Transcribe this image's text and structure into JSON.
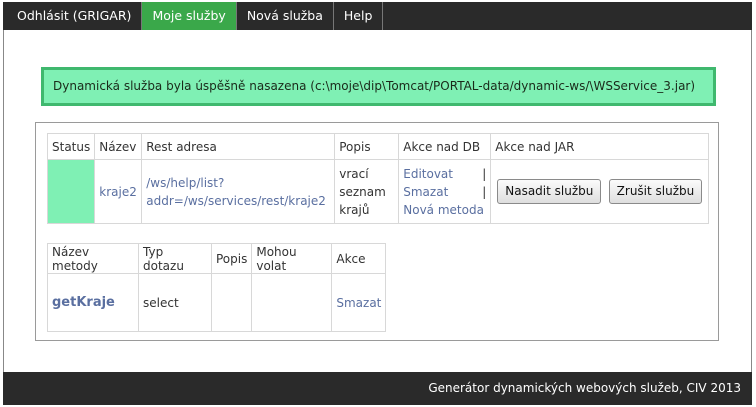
{
  "nav": {
    "items": [
      {
        "label": "Odhlásit (GRIGAR)",
        "active": false
      },
      {
        "label": "Moje služby",
        "active": true
      },
      {
        "label": "Nová služba",
        "active": false
      },
      {
        "label": "Help",
        "active": false
      }
    ]
  },
  "alert": {
    "message": "Dynamická služba byla úspěšně nasazena (c:\\moje\\dip\\Tomcat/PORTAL-data/dynamic-ws/\\WSService_3.jar)"
  },
  "services_table": {
    "headers": [
      "Status",
      "Název",
      "Rest adresa",
      "Popis",
      "Akce nad DB",
      "Akce nad JAR"
    ],
    "row": {
      "name": "kraje2",
      "rest_line1": "/ws/help/list?",
      "rest_line2": "addr=/ws/services/rest/kraje2",
      "desc_line1": "vrací",
      "desc_line2": "seznam",
      "desc_line3": "krajů",
      "edit": "Editovat",
      "delete": "Smazat",
      "new_method": "Nová metoda",
      "pipe": "|",
      "deploy": "Nasadit službu",
      "cancel": "Zrušit službu"
    }
  },
  "methods_table": {
    "headers": [
      "Název metody",
      "Typ dotazu",
      "Popis",
      "Mohou volat",
      "Akce"
    ],
    "row": {
      "name": "getKraje",
      "type": "select",
      "desc": "",
      "callers": "",
      "delete": "Smazat"
    }
  },
  "footer": {
    "text": "Generátor dynamických webových služeb, CIV 2013"
  },
  "colors": {
    "nav_bg": "#2a2a2a",
    "nav_active": "#3aa84a",
    "alert_bg": "#7ff0b4",
    "alert_border": "#3fb86e",
    "link": "#5a6fa0"
  }
}
